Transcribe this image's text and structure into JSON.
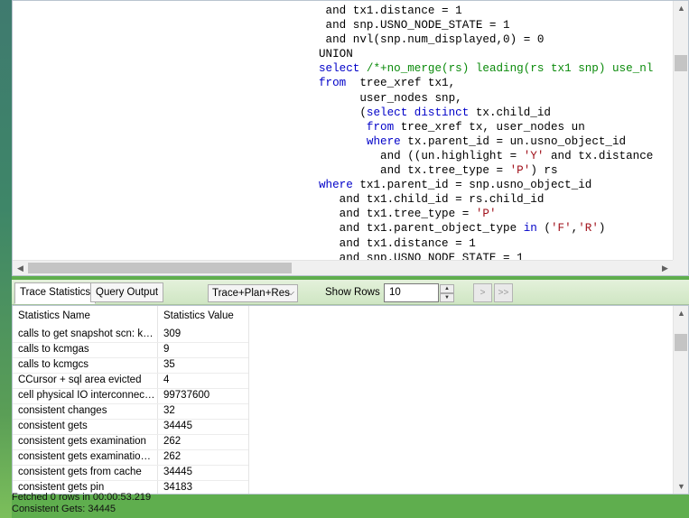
{
  "editor": {
    "lines": [
      [
        {
          "t": " and tx1.distance = 1"
        }
      ],
      [
        {
          "t": " and snp.USNO_NODE_STATE = 1"
        }
      ],
      [
        {
          "t": " and nvl(snp.num_displayed,0) = 0"
        }
      ],
      [
        {
          "t": "UNION"
        }
      ],
      [
        {
          "t": "select ",
          "c": "kw"
        },
        {
          "t": "/*+no_merge(rs) leading(rs tx1 snp) use_nl",
          "c": "com"
        }
      ],
      [
        {
          "t": "from ",
          "c": "kw"
        },
        {
          "t": " tree_xref tx1,"
        }
      ],
      [
        {
          "t": "      user_nodes snp,"
        }
      ],
      [
        {
          "t": "      (",
          "c": ""
        },
        {
          "t": "select distinct ",
          "c": "kw"
        },
        {
          "t": "tx.child_id"
        }
      ],
      [
        {
          "t": "       "
        },
        {
          "t": "from ",
          "c": "kw"
        },
        {
          "t": "tree_xref tx, user_nodes un"
        }
      ],
      [
        {
          "t": "       "
        },
        {
          "t": "where ",
          "c": "kw"
        },
        {
          "t": "tx.parent_id = un.usno_object_id"
        }
      ],
      [
        {
          "t": "         and ((un.highlight = "
        },
        {
          "t": "'Y'",
          "c": "str"
        },
        {
          "t": " and tx.distance"
        }
      ],
      [
        {
          "t": "         and tx.tree_type = "
        },
        {
          "t": "'P'",
          "c": "str"
        },
        {
          "t": ") rs"
        }
      ],
      [
        {
          "t": "where ",
          "c": "kw"
        },
        {
          "t": "tx1.parent_id = snp.usno_object_id"
        }
      ],
      [
        {
          "t": "   and tx1.child_id = rs.child_id"
        }
      ],
      [
        {
          "t": "   and tx1.tree_type = "
        },
        {
          "t": "'P'",
          "c": "str"
        }
      ],
      [
        {
          "t": "   and tx1.parent_object_type "
        },
        {
          "t": "in",
          "c": "kw"
        },
        {
          "t": " ("
        },
        {
          "t": "'F'",
          "c": "str"
        },
        {
          "t": ","
        },
        {
          "t": "'R'",
          "c": "str"
        },
        {
          "t": ")"
        }
      ],
      [
        {
          "t": "   and tx1.distance = 1"
        }
      ],
      [
        {
          "t": "   and snp.USNO_NODE_STATE = 1"
        }
      ]
    ]
  },
  "tabs": {
    "trace_statistics": "Trace Statistics",
    "query_output": "Query Output"
  },
  "toolbar": {
    "mode_value": "Trace+Plan+Res",
    "show_rows_label": "Show Rows",
    "show_rows_value": "10",
    "next_label": ">",
    "last_label": ">>"
  },
  "grid": {
    "col_name": "Statistics Name",
    "col_value": "Statistics Value",
    "rows": [
      {
        "name": "calls to get snapshot scn: kc...",
        "value": "309"
      },
      {
        "name": "calls to kcmgas",
        "value": "9"
      },
      {
        "name": "calls to kcmgcs",
        "value": "35"
      },
      {
        "name": "CCursor + sql area evicted",
        "value": "4"
      },
      {
        "name": "cell physical IO interconnect ...",
        "value": "99737600"
      },
      {
        "name": "consistent changes",
        "value": "32"
      },
      {
        "name": "consistent gets",
        "value": "34445"
      },
      {
        "name": "consistent gets examination",
        "value": "262"
      },
      {
        "name": "consistent gets examination ...",
        "value": "262"
      },
      {
        "name": "consistent gets from cache",
        "value": "34445"
      },
      {
        "name": "consistent gets pin",
        "value": "34183"
      }
    ]
  },
  "status": {
    "fetched": "Fetched 0 rows in 00:00:53.219",
    "consistent_gets": "Consistent Gets: 34445"
  },
  "colors": {
    "keyword": "#0000c8",
    "string": "#a0101a",
    "comment": "#0a8a0a",
    "background_green": "#5fae4e"
  }
}
